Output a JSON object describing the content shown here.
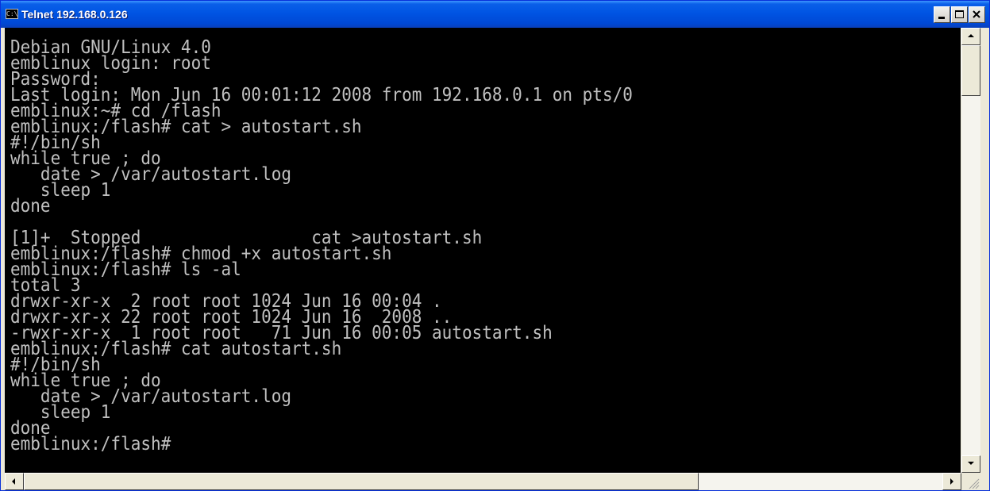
{
  "window": {
    "title": "Telnet 192.168.0.126",
    "icon": "console-window-icon",
    "icon_text": "C:\\"
  },
  "titlebar_buttons": {
    "minimize": "minimize-icon",
    "maximize": "maximize-icon",
    "close": "close-icon"
  },
  "console": {
    "background": "#000000",
    "foreground": "#c0c0c0",
    "lines": [
      "Debian GNU/Linux 4.0",
      "emblinux login: root",
      "Password:",
      "Last login: Mon Jun 16 00:01:12 2008 from 192.168.0.1 on pts/0",
      "emblinux:~# cd /flash",
      "emblinux:/flash# cat > autostart.sh",
      "#!/bin/sh",
      "while true ; do",
      "   date > /var/autostart.log",
      "   sleep 1",
      "done",
      "",
      "[1]+  Stopped                 cat >autostart.sh",
      "emblinux:/flash# chmod +x autostart.sh",
      "emblinux:/flash# ls -al",
      "total 3",
      "drwxr-xr-x  2 root root 1024 Jun 16 00:04 .",
      "drwxr-xr-x 22 root root 1024 Jun 16  2008 ..",
      "-rwxr-xr-x  1 root root   71 Jun 16 00:05 autostart.sh",
      "emblinux:/flash# cat autostart.sh",
      "#!/bin/sh",
      "while true ; do",
      "   date > /var/autostart.log",
      "   sleep 1",
      "done",
      "emblinux:/flash#"
    ]
  },
  "scrollbars": {
    "up": "scroll-up-arrow-icon",
    "down": "scroll-down-arrow-icon",
    "left": "scroll-left-arrow-icon",
    "right": "scroll-right-arrow-icon"
  }
}
